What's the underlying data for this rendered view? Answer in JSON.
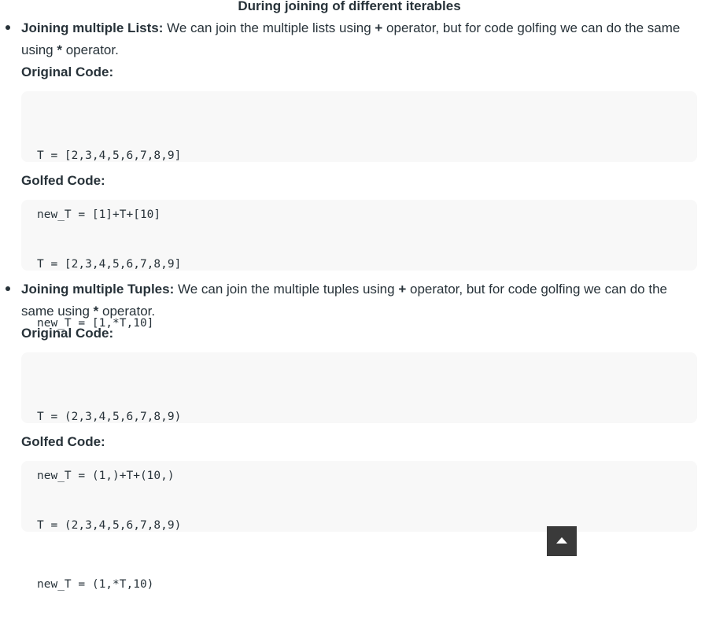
{
  "heading": "During joining of different iterables",
  "sections": [
    {
      "title": "Joining multiple Lists:",
      "intro_a": " We can join the multiple lists using ",
      "plus": "+",
      "intro_b": " operator, but for code golfing we can do the same using ",
      "star": "*",
      "intro_c": " operator.",
      "original_label": "Original Code:",
      "original_code": [
        "T = [2,3,4,5,6,7,8,9]",
        "new_T = [1]+T+[10]"
      ],
      "golfed_label": "Golfed Code:",
      "golfed_code": [
        "T = [2,3,4,5,6,7,8,9]",
        "new_T = [1,*T,10]"
      ]
    },
    {
      "title": "Joining multiple Tuples:",
      "intro_a": " We can join the multiple tuples using ",
      "plus": "+",
      "intro_b": " operator, but for code golfing we can do the same using ",
      "star": "*",
      "intro_c": " operator.",
      "original_label": "Original Code:",
      "original_code": [
        "T = (2,3,4,5,6,7,8,9)",
        "new_T = (1,)+T+(10,)"
      ],
      "golfed_label": "Golfed Code:",
      "golfed_code": [
        "T = (2,3,4,5,6,7,8,9)",
        "new_T = (1,*T,10)"
      ]
    }
  ],
  "scroll_top_icon": "chevron-up-icon"
}
